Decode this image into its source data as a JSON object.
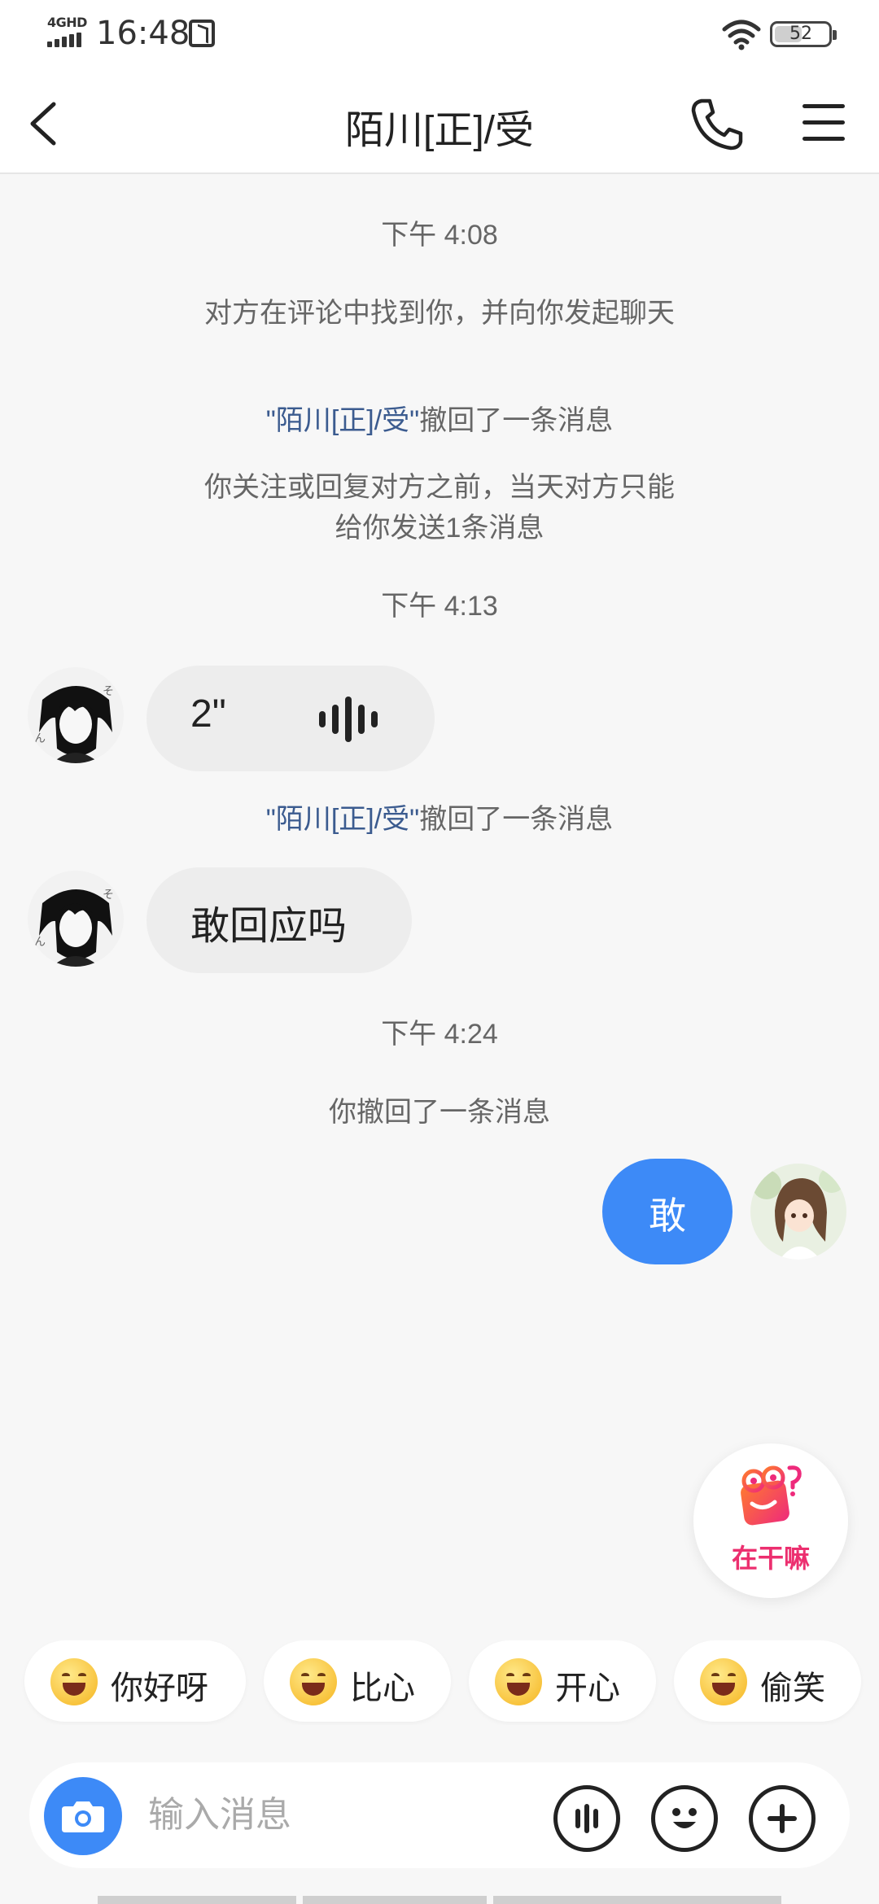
{
  "status_bar": {
    "network": "4GHD",
    "time": "16:48",
    "battery": "52",
    "battery_level_percent": 52,
    "icons": [
      "signal-icon",
      "nfc-icon",
      "wifi-icon",
      "battery-icon"
    ]
  },
  "header": {
    "title": "陌川[正]/受",
    "icons": [
      "back-arrow-icon",
      "phone-icon",
      "menu-icon"
    ]
  },
  "messages": {
    "time1": "下午 4:08",
    "notice1": "对方在评论中找到你，并向你发起聊天",
    "recall1_name": "\"陌川[正]/受\"",
    "recall1_text": "撤回了一条消息",
    "notice2": "你关注或回复对方之前，当天对方只能给你发送1条消息",
    "time2": "下午 4:13",
    "voice_duration": "2\"",
    "recall2_name": "\"陌川[正]/受\"",
    "recall2_text": "撤回了一条消息",
    "incoming_text": "敢回应吗",
    "time3": "下午 4:24",
    "self_recall": "你撤回了一条消息",
    "outgoing_text": "敢"
  },
  "widget": {
    "label": "在干嘛",
    "icon": "chat-bubble-icon"
  },
  "quick_replies": [
    {
      "label": "你好呀",
      "icon": "hello-emoji-icon"
    },
    {
      "label": "比心",
      "icon": "love-emoji-icon"
    },
    {
      "label": "开心",
      "icon": "happy-emoji-icon"
    },
    {
      "label": "偷笑",
      "icon": "giggle-emoji-icon"
    }
  ],
  "input_bar": {
    "placeholder": "输入消息",
    "icons": [
      "camera-icon",
      "voice-icon",
      "emoji-icon",
      "plus-icon"
    ]
  },
  "colors": {
    "accent_blue": "#3d8af7",
    "widget_pink": "#ec2f6f",
    "name_link": "#3b5b8f"
  }
}
